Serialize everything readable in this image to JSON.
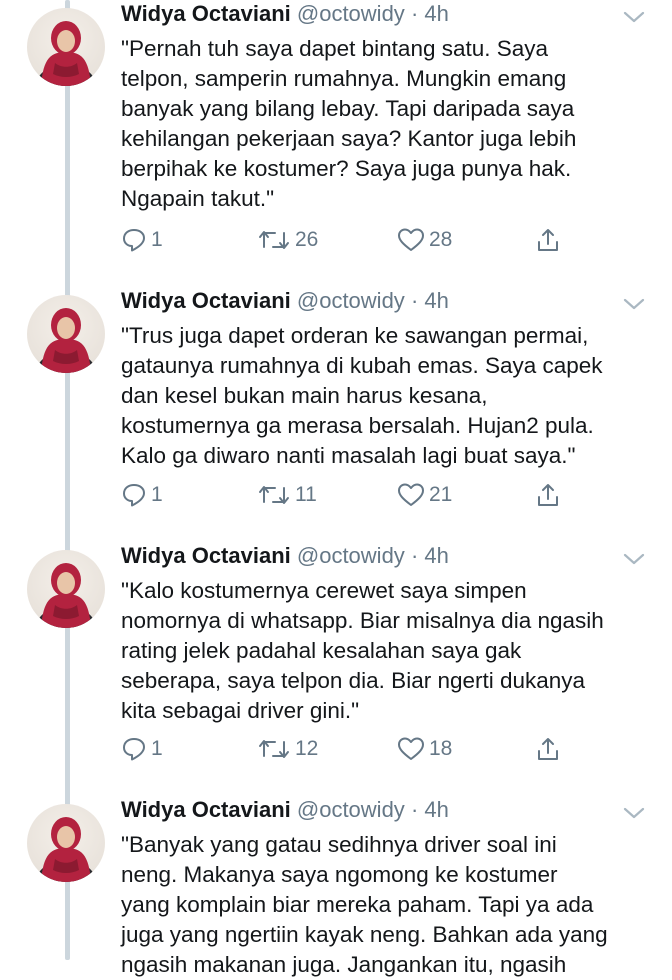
{
  "tweets": [
    {
      "name": "Widya Octaviani",
      "handle": "@octowidy",
      "separator": "·",
      "time": "4h",
      "text": "\"Pernah tuh saya dapet bintang satu. Saya\ntelpon, samperin rumahnya. Mungkin emang\nbanyak yang bilang lebay. Tapi daripada saya\nkehilangan pekerjaan saya? Kantor juga lebih\nberpihak ke kostumer? Saya juga punya hak.\nNgapain takut.\"",
      "replies": "1",
      "retweets": "26",
      "likes": "28"
    },
    {
      "name": "Widya Octaviani",
      "handle": "@octowidy",
      "separator": "·",
      "time": "4h",
      "text": "\"Trus juga dapet orderan ke sawangan permai,\ngataunya rumahnya di kubah emas. Saya capek\ndan kesel bukan main harus kesana,\nkostumernya ga merasa bersalah. Hujan2 pula.\nKalo ga diwaro nanti masalah lagi buat saya.\"",
      "replies": "1",
      "retweets": "11",
      "likes": "21"
    },
    {
      "name": "Widya Octaviani",
      "handle": "@octowidy",
      "separator": "·",
      "time": "4h",
      "text": "\"Kalo kostumernya cerewet saya simpen\nnomornya di whatsapp. Biar misalnya dia ngasih\nrating jelek padahal kesalahan saya gak\nseberapa, saya telpon dia. Biar ngerti dukanya\nkita sebagai driver gini.\"",
      "replies": "1",
      "retweets": "12",
      "likes": "18"
    },
    {
      "name": "Widya Octaviani",
      "handle": "@octowidy",
      "separator": "·",
      "time": "4h",
      "text": "\"Banyak yang gatau sedihnya driver soal ini\nneng. Makanya saya ngomong ke kostumer\nyang komplain biar mereka paham. Tapi ya ada\njuga yang ngertiin kayak neng. Bahkan ada yang\nngasih makanan juga. Jangankan itu, ngasih"
    }
  ],
  "icons": {
    "reply": "reply-icon",
    "retweet": "retweet-icon",
    "like": "heart-icon",
    "share": "share-icon",
    "menu": "chevron-down-icon"
  },
  "colors": {
    "text": "#14171a",
    "muted": "#657786",
    "thread_line": "#ccd6dd",
    "hijab": "#b3223f"
  }
}
